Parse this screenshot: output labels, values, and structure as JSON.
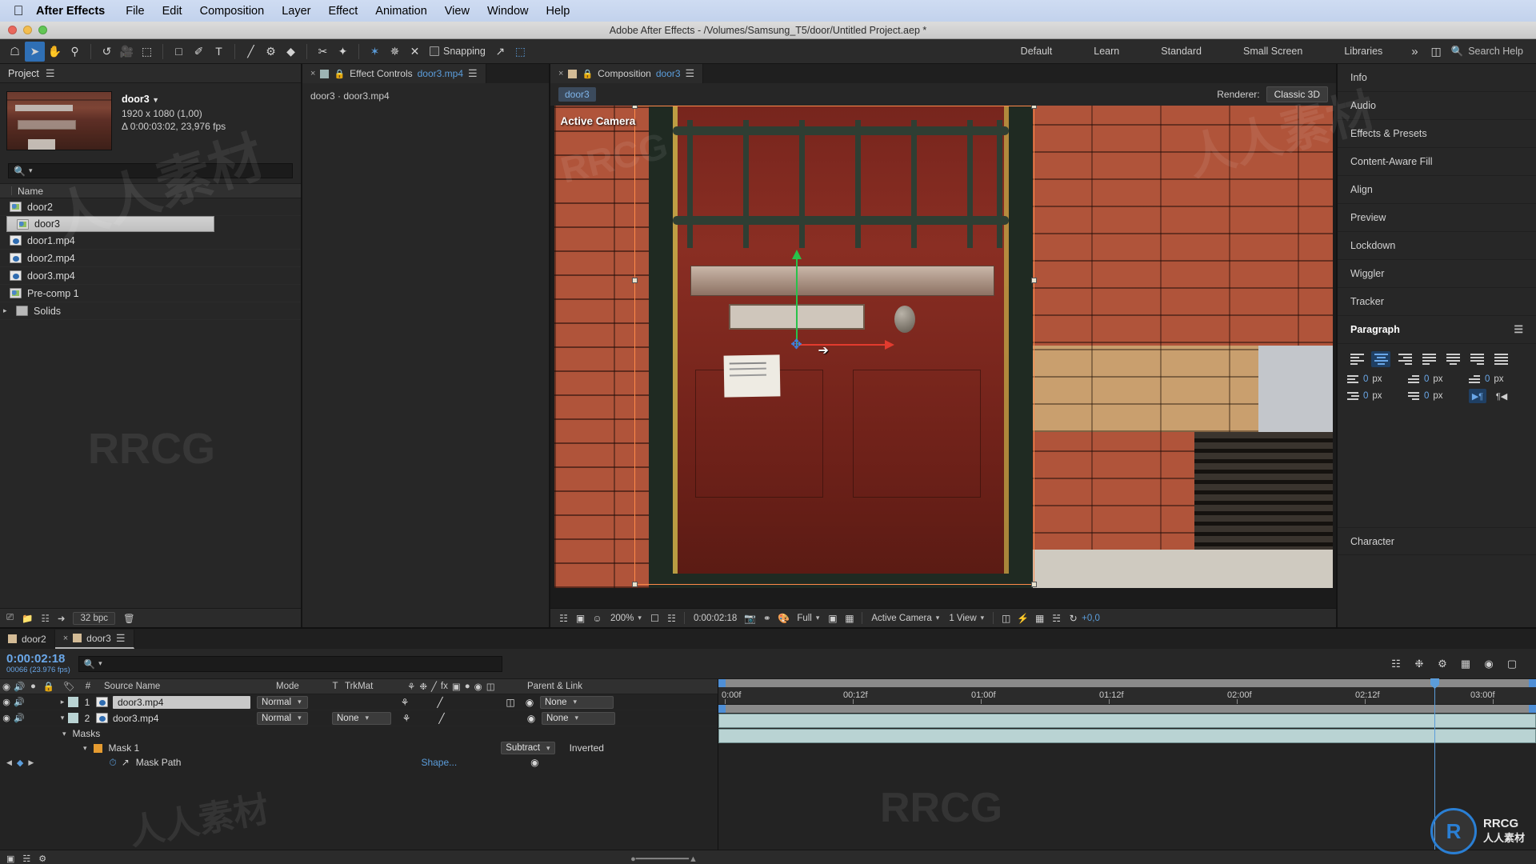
{
  "macbar": {
    "apple_icon": "apple-logo",
    "app_name": "After Effects",
    "menus": [
      "File",
      "Edit",
      "Composition",
      "Layer",
      "Effect",
      "Animation",
      "View",
      "Window",
      "Help"
    ]
  },
  "titlebar": {
    "title": "Adobe After Effects - /Volumes/Samsung_T5/door/Untitled Project.aep *"
  },
  "toolbar": {
    "tools": [
      {
        "name": "home-icon",
        "glyph": "⌂"
      },
      {
        "name": "selection-tool-icon",
        "glyph": "➤"
      },
      {
        "name": "hand-tool-icon",
        "glyph": "✋"
      },
      {
        "name": "zoom-tool-icon",
        "glyph": "⚲"
      },
      {
        "name": "rotation-tool-icon",
        "glyph": "↺"
      },
      {
        "name": "camera-tool-icon",
        "glyph": "▶"
      },
      {
        "name": "pan-behind-tool-icon",
        "glyph": "⬚"
      },
      {
        "name": "shape-tool-icon",
        "glyph": "□"
      },
      {
        "name": "pen-tool-icon",
        "glyph": "✒"
      },
      {
        "name": "type-tool-icon",
        "glyph": "T"
      },
      {
        "name": "brush-tool-icon",
        "glyph": "╱"
      },
      {
        "name": "clone-stamp-tool-icon",
        "glyph": "⚓"
      },
      {
        "name": "eraser-tool-icon",
        "glyph": "◆"
      },
      {
        "name": "roto-brush-tool-icon",
        "glyph": "✄"
      },
      {
        "name": "puppet-pin-tool-icon",
        "glyph": "✦"
      }
    ],
    "axis_tools": [
      {
        "name": "local-axis-mode-icon",
        "glyph": "✶"
      },
      {
        "name": "world-axis-mode-icon",
        "glyph": "✵"
      },
      {
        "name": "view-axis-mode-icon",
        "glyph": "✕"
      }
    ],
    "snapping_label": "Snapping",
    "workspaces": [
      "Default",
      "Learn",
      "Standard",
      "Small Screen",
      "Libraries"
    ],
    "more_icon": "chevron-double-right-icon",
    "layout_icon": "workspace-layout-icon",
    "search_icon": "search-icon",
    "search_help_label": "Search Help"
  },
  "project": {
    "panel_title": "Project",
    "menu_icon": "panel-menu-icon",
    "selected_item": {
      "name": "door3",
      "dimensions": "1920 x 1080 (1,00)",
      "duration": "Δ 0:00:03:02, 23,976 fps"
    },
    "search_placeholder": "",
    "search_icon": "search-icon",
    "column_header": "Name",
    "items": [
      {
        "label": "door2",
        "type": "comp",
        "selected": false,
        "expandable": false
      },
      {
        "label": "door3",
        "type": "comp",
        "selected": true,
        "expandable": false
      },
      {
        "label": "door1.mp4",
        "type": "mp4",
        "selected": false,
        "expandable": false
      },
      {
        "label": "door2.mp4",
        "type": "mp4",
        "selected": false,
        "expandable": false
      },
      {
        "label": "door3.mp4",
        "type": "mp4",
        "selected": false,
        "expandable": false
      },
      {
        "label": "Pre-comp 1",
        "type": "comp",
        "selected": false,
        "expandable": false
      },
      {
        "label": "Solids",
        "type": "folder",
        "selected": false,
        "expandable": true
      }
    ],
    "footer": {
      "bpc": "32 bpc",
      "icons": [
        "new-comp-icon",
        "new-folder-icon",
        "project-settings-icon",
        "interpret-footage-icon",
        "delete-icon"
      ]
    }
  },
  "effect_controls": {
    "tab_close_icon": "close-icon",
    "tab_lock_icon": "lock-icon",
    "tab_label": "Effect Controls",
    "tab_file": "door3.mp4",
    "menu_icon": "panel-menu-icon",
    "breadcrumb": "door3 · door3.mp4"
  },
  "composition": {
    "tab_close_icon": "close-icon",
    "tab_lock_icon": "lock-icon",
    "tab_label": "Composition",
    "tab_name": "door3",
    "menu_icon": "panel-menu-icon",
    "breadcrumb": "door3",
    "renderer_label": "Renderer:",
    "renderer_value": "Classic 3D",
    "viewer_label": "Active Camera",
    "footer": {
      "magnification": "200%",
      "timecode": "0:00:02:18",
      "resolution": "Full",
      "view_camera": "Active Camera",
      "view_layout": "1 View",
      "exposure": "+0,0",
      "icons": [
        "always-preview-icon",
        "toggle-viewer-icon",
        "3d-glasses-icon",
        "region-of-interest-icon",
        "grid-guides-icon",
        "snapshot-icon",
        "show-snapshot-icon",
        "channel-icon",
        "transparency-grid-icon",
        "toggle-mask-icon",
        "timeline-icon",
        "comp-flowchart-icon",
        "reset-exposure-icon"
      ]
    }
  },
  "right_dock": {
    "panels": [
      "Info",
      "Audio",
      "Effects & Presets",
      "Content-Aware Fill",
      "Align",
      "Preview",
      "Lockdown",
      "Wiggler",
      "Tracker"
    ],
    "paragraph": {
      "title": "Paragraph",
      "menu_icon": "panel-menu-icon",
      "align_buttons": [
        {
          "name": "align-left-icon",
          "active": false
        },
        {
          "name": "align-center-icon",
          "active": true
        },
        {
          "name": "align-right-icon",
          "active": false
        },
        {
          "name": "justify-last-left-icon",
          "active": false
        },
        {
          "name": "justify-last-center-icon",
          "active": false
        },
        {
          "name": "justify-last-right-icon",
          "active": false
        },
        {
          "name": "justify-all-icon",
          "active": false
        }
      ],
      "fields": [
        {
          "icon": "indent-left-margin-icon",
          "value": "0",
          "unit": "px"
        },
        {
          "icon": "indent-first-line-icon",
          "value": "0",
          "unit": "px"
        },
        {
          "icon": "space-before-icon",
          "value": "0",
          "unit": "px"
        },
        {
          "icon": "indent-right-margin-icon",
          "value": "0",
          "unit": "px"
        },
        {
          "icon": "indent-last-line-icon",
          "value": "0",
          "unit": "px"
        }
      ],
      "direction_ltr_icon": "text-direction-ltr-icon",
      "direction_rtl_icon": "text-direction-rtl-icon"
    },
    "character_panel": "Character"
  },
  "timeline": {
    "tabs": [
      {
        "label": "door2",
        "active": false,
        "closeable": false
      },
      {
        "label": "door3",
        "active": true,
        "closeable": true
      }
    ],
    "menu_icon": "panel-menu-icon",
    "current_time": "0:00:02:18",
    "current_frame": "00066 (23.976 fps)",
    "search_icon": "search-icon",
    "switch_icons": [
      "composition-mini-flowchart-icon",
      "draft-3d-icon",
      "hide-shy-layers-icon",
      "frame-blending-icon",
      "motion-blur-icon",
      "graph-editor-icon"
    ],
    "columns": [
      {
        "name": "video-toggle-icon",
        "label": ""
      },
      {
        "name": "audio-toggle-icon",
        "label": ""
      },
      {
        "name": "solo-toggle-icon",
        "label": ""
      },
      {
        "name": "lock-toggle-icon",
        "label": ""
      },
      {
        "name": "label-column-icon",
        "label": ""
      },
      {
        "name": "layer-number-column",
        "label": "#"
      },
      {
        "name": "source-name-column",
        "label": "Source Name"
      },
      {
        "name": "mode-column",
        "label": "Mode"
      },
      {
        "name": "track-matte-t-column",
        "label": "T"
      },
      {
        "name": "trkmat-column",
        "label": "TrkMat"
      },
      {
        "name": "switches-column",
        "label": ""
      },
      {
        "name": "parent-link-column",
        "label": "Parent & Link"
      }
    ],
    "switch_header_icons": [
      "shy-icon",
      "collapse-transformations-icon",
      "quality-icon",
      "effects-fx-icon",
      "frame-blend-icon",
      "motion-blur-icon",
      "adjustment-layer-icon",
      "3d-layer-icon"
    ],
    "layers": [
      {
        "number": "1",
        "source_name": "door3.mp4",
        "mode": "Normal",
        "trkmat": "",
        "parent": "None",
        "selected": true,
        "expanded": false
      },
      {
        "number": "2",
        "source_name": "door3.mp4",
        "mode": "Normal",
        "trkmat": "None",
        "parent": "None",
        "selected": false,
        "expanded": true
      }
    ],
    "masks_group": {
      "label": "Masks",
      "mask": {
        "label": "Mask 1",
        "mode": "Subtract",
        "inverted_label": "Inverted",
        "property": "Mask Path",
        "property_value": "Shape...",
        "stopwatch_icon": "stopwatch-icon",
        "graph_icon": "keyframe-graph-icon"
      }
    },
    "ruler": {
      "labels": [
        "0:00f",
        "00:12f",
        "01:00f",
        "01:12f",
        "02:00f",
        "02:12f",
        "03:00f"
      ],
      "playhead_position_pct": 87.5
    },
    "footer_icons": [
      "toggle-switches-modes-icon",
      "comp-flowchart-icon",
      "render-queue-icon"
    ],
    "zoom_slider_icon": "zoom-slider"
  },
  "watermarks": {
    "brand": "RRCG",
    "cn_text": "人人素材",
    "badge_logo": "R",
    "badge_line1": "RRCG",
    "badge_line2": "人人素材"
  }
}
